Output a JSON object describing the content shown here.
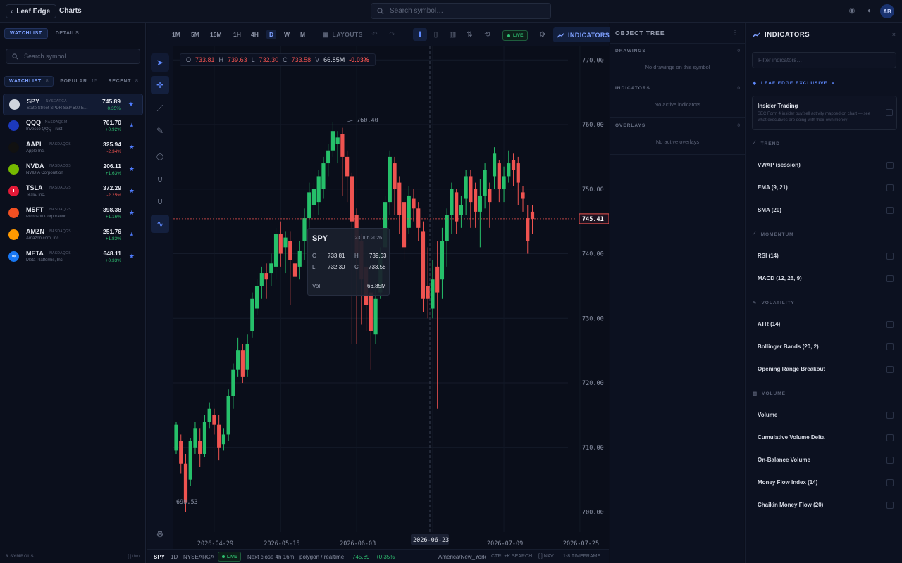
{
  "app": {
    "brand": "Leaf Edge",
    "section": "Charts",
    "search_placeholder": "Search symbol…",
    "avatar": "AB"
  },
  "left": {
    "tabs": [
      "WATCHLIST",
      "DETAILS"
    ],
    "search_placeholder": "Search symbol…",
    "subtabs": [
      {
        "label": "WATCHLIST",
        "count": "8"
      },
      {
        "label": "POPULAR",
        "count": "15"
      },
      {
        "label": "RECENT",
        "count": "8"
      }
    ],
    "items": [
      {
        "sym": "SPY",
        "exch": "NYSEARCA",
        "name": "State Street SPDR S&P 500 E…",
        "price": "745.89",
        "chg": "+0.35%",
        "dir": "pos",
        "logo": "#cfd4dd",
        "logo_txt": ""
      },
      {
        "sym": "QQQ",
        "exch": "NASDAQGM",
        "name": "Invesco QQQ Trust",
        "price": "701.70",
        "chg": "+0.92%",
        "dir": "pos",
        "logo": "#1c39bb",
        "logo_txt": ""
      },
      {
        "sym": "AAPL",
        "exch": "NASDAQGS",
        "name": "Apple Inc.",
        "price": "325.94",
        "chg": "-2.34%",
        "dir": "neg",
        "logo": "#111111",
        "logo_txt": ""
      },
      {
        "sym": "NVDA",
        "exch": "NASDAQGS",
        "name": "NVIDIA Corporation",
        "price": "206.11",
        "chg": "+1.63%",
        "dir": "pos",
        "logo": "#76b900",
        "logo_txt": ""
      },
      {
        "sym": "TSLA",
        "exch": "NASDAQGS",
        "name": "Tesla, Inc.",
        "price": "372.29",
        "chg": "-2.25%",
        "dir": "neg",
        "logo": "#e31937",
        "logo_txt": "T"
      },
      {
        "sym": "MSFT",
        "exch": "NASDAQGS",
        "name": "Microsoft Corporation",
        "price": "398.38",
        "chg": "+1.16%",
        "dir": "pos",
        "logo": "#f25022",
        "logo_txt": ""
      },
      {
        "sym": "AMZN",
        "exch": "NASDAQGS",
        "name": "Amazon.com, Inc.",
        "price": "251.76",
        "chg": "+1.83%",
        "dir": "pos",
        "logo": "#ff9900",
        "logo_txt": ""
      },
      {
        "sym": "META",
        "exch": "NASDAQGS",
        "name": "Meta Platforms, Inc.",
        "price": "648.11",
        "chg": "+0.33%",
        "dir": "pos",
        "logo": "#1877f2",
        "logo_txt": "∞"
      }
    ],
    "footer": "8 SYMBOLS",
    "footer_right": "[ ] tbm"
  },
  "toolbar": {
    "timeframes": [
      "1M",
      "5M",
      "15M",
      "1H",
      "4H",
      "D",
      "W",
      "M"
    ],
    "active_tf": "D",
    "layouts": "LAYOUTS",
    "live": "LIVE",
    "indicators": "INDICATORS"
  },
  "ohlc": {
    "o": "733.81",
    "h": "739.63",
    "l": "732.30",
    "c": "733.58",
    "v": "66.85M",
    "chg": "-0.03%"
  },
  "tooltip": {
    "sym": "SPY",
    "date": "23 Jun 2026",
    "o": "733.81",
    "h": "739.63",
    "l": "732.30",
    "c": "733.58",
    "vol_label": "Vol",
    "vol": "66.85M"
  },
  "chart_data": {
    "type": "candlestick",
    "symbol": "SPY",
    "y_ticks": [
      "770.00",
      "760.00",
      "750.00",
      "740.00",
      "730.00",
      "720.00",
      "710.00",
      "700.00"
    ],
    "ylim": [
      696.9,
      772.1
    ],
    "x_ticks": [
      "2026-04-29",
      "2026-05-15",
      "2026-06-03",
      "2026-06-23",
      "2026-07-09",
      "2026-07-25"
    ],
    "crosshair_date": "2026-06-23",
    "current_price": "745.41",
    "high_label": "760.40",
    "low_label": "698.53",
    "candles": [
      [
        709.5,
        713.5,
        709,
        714
      ],
      [
        711,
        707.5,
        706,
        712
      ],
      [
        707.5,
        701.5,
        700,
        709
      ],
      [
        705,
        711,
        704,
        711.5
      ],
      [
        710,
        713,
        709,
        714
      ],
      [
        711,
        709,
        707,
        713
      ],
      [
        709,
        714,
        708.5,
        715
      ],
      [
        714,
        716,
        713,
        717
      ],
      [
        715,
        713.5,
        712,
        716
      ],
      [
        713.5,
        710,
        708,
        715
      ],
      [
        710.5,
        712,
        709.5,
        713
      ],
      [
        712,
        718,
        711,
        719
      ],
      [
        718,
        722,
        716,
        723
      ],
      [
        722,
        725,
        721,
        727
      ],
      [
        725,
        721,
        720,
        726
      ],
      [
        722,
        726,
        721,
        727.5
      ],
      [
        728,
        733,
        727,
        734
      ],
      [
        731.5,
        735,
        730.5,
        736
      ],
      [
        735,
        737,
        733,
        738
      ],
      [
        737,
        736,
        733,
        738.5
      ],
      [
        737,
        738.5,
        735,
        740
      ],
      [
        738,
        743,
        736,
        744
      ],
      [
        743,
        740,
        738,
        745
      ],
      [
        741,
        742.5,
        737,
        743.5
      ],
      [
        742,
        739,
        732,
        743.5
      ],
      [
        738.5,
        736.5,
        731,
        739
      ],
      [
        738,
        740.5,
        736,
        742
      ],
      [
        742,
        745.5,
        739,
        747
      ],
      [
        745.5,
        749.5,
        744,
        751
      ],
      [
        747.5,
        750,
        745.5,
        751
      ],
      [
        748,
        752,
        746,
        753
      ],
      [
        750,
        754,
        748.5,
        755
      ],
      [
        754,
        756,
        752,
        757
      ],
      [
        756,
        759,
        755,
        760.4
      ],
      [
        757,
        758,
        754,
        759
      ],
      [
        758.5,
        755,
        749,
        759.5
      ],
      [
        755,
        752,
        748,
        756
      ],
      [
        752,
        745,
        726,
        752.5
      ],
      [
        746,
        740,
        726,
        747
      ],
      [
        742,
        736,
        729,
        743
      ],
      [
        738,
        732,
        728,
        739.5
      ],
      [
        734,
        728,
        722,
        736
      ],
      [
        727.5,
        733,
        726,
        735
      ],
      [
        734,
        740,
        733,
        741
      ],
      [
        741,
        748,
        739,
        749
      ],
      [
        748,
        755,
        746,
        756
      ],
      [
        754,
        750,
        746,
        755
      ],
      [
        751,
        746,
        743,
        752
      ],
      [
        748,
        741,
        739,
        749.5
      ],
      [
        744,
        749,
        743,
        750.5
      ],
      [
        748.5,
        747,
        745,
        750
      ],
      [
        747,
        744,
        742,
        748
      ],
      [
        743.5,
        733,
        731,
        745
      ],
      [
        735,
        733,
        730,
        741
      ],
      [
        731.5,
        736,
        730,
        739
      ],
      [
        738,
        734,
        716,
        742
      ],
      [
        736,
        742,
        733,
        744
      ],
      [
        742,
        746,
        738,
        747
      ],
      [
        746,
        750,
        743,
        751
      ],
      [
        749.5,
        745,
        743,
        750
      ],
      [
        746,
        747.5,
        744,
        749
      ],
      [
        748.5,
        752,
        746,
        753
      ],
      [
        752,
        748,
        744,
        753
      ],
      [
        750,
        746.5,
        744,
        751
      ],
      [
        746.5,
        749,
        741,
        751.5
      ],
      [
        749,
        753,
        747,
        754
      ],
      [
        750,
        748,
        744,
        751
      ],
      [
        752,
        755.5,
        750,
        756.5
      ],
      [
        754,
        750,
        748,
        754.5
      ],
      [
        750,
        752,
        748,
        753.5
      ],
      [
        752,
        754,
        751,
        756
      ],
      [
        754.5,
        753,
        750.5,
        755.5
      ],
      [
        754,
        751,
        747.5,
        755
      ],
      [
        749.5,
        748.5,
        746.5,
        750.5
      ],
      [
        745.5,
        742,
        740,
        747.5
      ],
      [
        746.5,
        745.41,
        743,
        747.5
      ]
    ],
    "colors": {
      "up": "#26c06a",
      "down": "#ef5350"
    }
  },
  "status": {
    "sym": "SPY",
    "tf": "1D",
    "exch": "NYSEARCA",
    "live": "LIVE",
    "next_close": "Next close 4h 16m",
    "feed": "polygon / realtime",
    "price": "745.89",
    "chg": "+0.35%",
    "tz": "America/New_York",
    "h1": "CTRL+K SEARCH",
    "h2": "[ ] NAV",
    "h3": "1-8 TIMEFRAME"
  },
  "object_tree": {
    "title": "OBJECT TREE",
    "sections": [
      {
        "label": "DRAWINGS",
        "count": "0",
        "empty": "No drawings on this symbol"
      },
      {
        "label": "INDICATORS",
        "count": "0",
        "empty": "No active indicators"
      },
      {
        "label": "OVERLAYS",
        "count": "0",
        "empty": "No active overlays"
      }
    ]
  },
  "ind_panel": {
    "title": "INDICATORS",
    "filter_placeholder": "Filter indicators…",
    "exclusive_label": "LEAF EDGE EXCLUSIVE",
    "exclusive_item": {
      "name": "Insider Trading",
      "desc": "SEC Form 4 insider buy/sell activity mapped on chart — see what executives are doing with their own money"
    },
    "categories": [
      {
        "label": "TREND",
        "items": [
          "VWAP (session)",
          "EMA (9, 21)",
          "SMA (20)"
        ]
      },
      {
        "label": "MOMENTUM",
        "items": [
          "RSI (14)",
          "MACD (12, 26, 9)"
        ]
      },
      {
        "label": "VOLATILITY",
        "items": [
          "ATR (14)",
          "Bollinger Bands (20, 2)",
          "Opening Range Breakout"
        ]
      },
      {
        "label": "VOLUME",
        "items": [
          "Volume",
          "Cumulative Volume Delta",
          "On-Balance Volume",
          "Money Flow Index (14)",
          "Chaikin Money Flow (20)"
        ]
      }
    ]
  }
}
